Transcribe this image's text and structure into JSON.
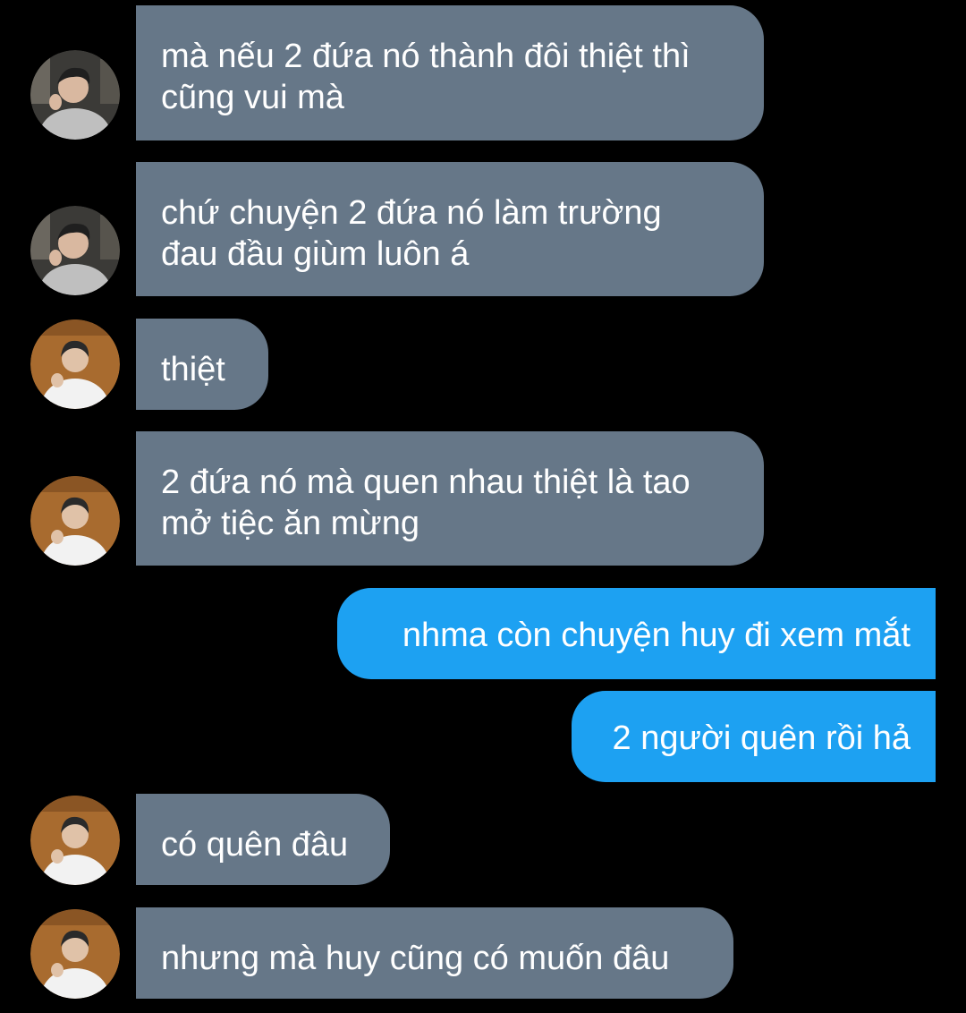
{
  "conversation": {
    "messages": [
      {
        "sender": "friend_a",
        "avatar_icon": "person-avatar-icon",
        "text": "mà nếu 2 đứa nó thành đôi thiệt thì\ncũng vui mà"
      },
      {
        "sender": "friend_a",
        "avatar_icon": "person-avatar-icon",
        "text": "chứ chuyện 2 đứa nó làm trường\nđau đầu giùm luôn á"
      },
      {
        "sender": "friend_b",
        "avatar_icon": "person-avatar-icon",
        "text": "thiệt"
      },
      {
        "sender": "friend_b",
        "avatar_icon": "person-avatar-icon",
        "text": "2 đứa nó mà quen nhau thiệt là tao\nmở tiệc ăn mừng"
      },
      {
        "sender": "me",
        "text": "nhma còn chuyện huy đi xem mắt"
      },
      {
        "sender": "me",
        "text": "2 người quên rồi hả"
      },
      {
        "sender": "friend_b",
        "avatar_icon": "person-avatar-icon",
        "text": "có quên đâu"
      },
      {
        "sender": "friend_b",
        "avatar_icon": "person-avatar-icon",
        "text": "nhưng mà huy cũng có muốn đâu"
      }
    ]
  },
  "colors": {
    "background": "#000000",
    "incoming_bubble": "#667788",
    "outgoing_bubble": "#1da1f2",
    "text": "#ffffff"
  }
}
